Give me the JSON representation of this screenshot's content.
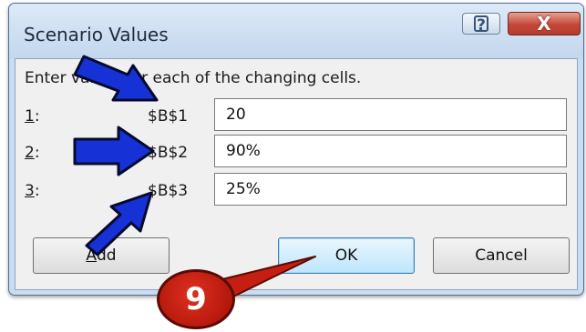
{
  "dialog": {
    "title": "Scenario Values",
    "help_glyph": "?",
    "close_glyph": "X",
    "instruction": "Enter values for each of the changing cells.",
    "rows": [
      {
        "num": "1",
        "suffix": ":",
        "cell": "$B$1",
        "value": "20"
      },
      {
        "num": "2",
        "suffix": ":",
        "cell": "$B$2",
        "value": "90%"
      },
      {
        "num": "3",
        "suffix": ":",
        "cell": "$B$3",
        "value": "25%"
      }
    ],
    "buttons": {
      "add_mnemonic": "A",
      "add_rest": "dd",
      "ok": "OK",
      "cancel": "Cancel"
    }
  },
  "annotation": {
    "step_number": "9",
    "arrow_color": "#1631d6",
    "badge_color": "#c61f12"
  }
}
